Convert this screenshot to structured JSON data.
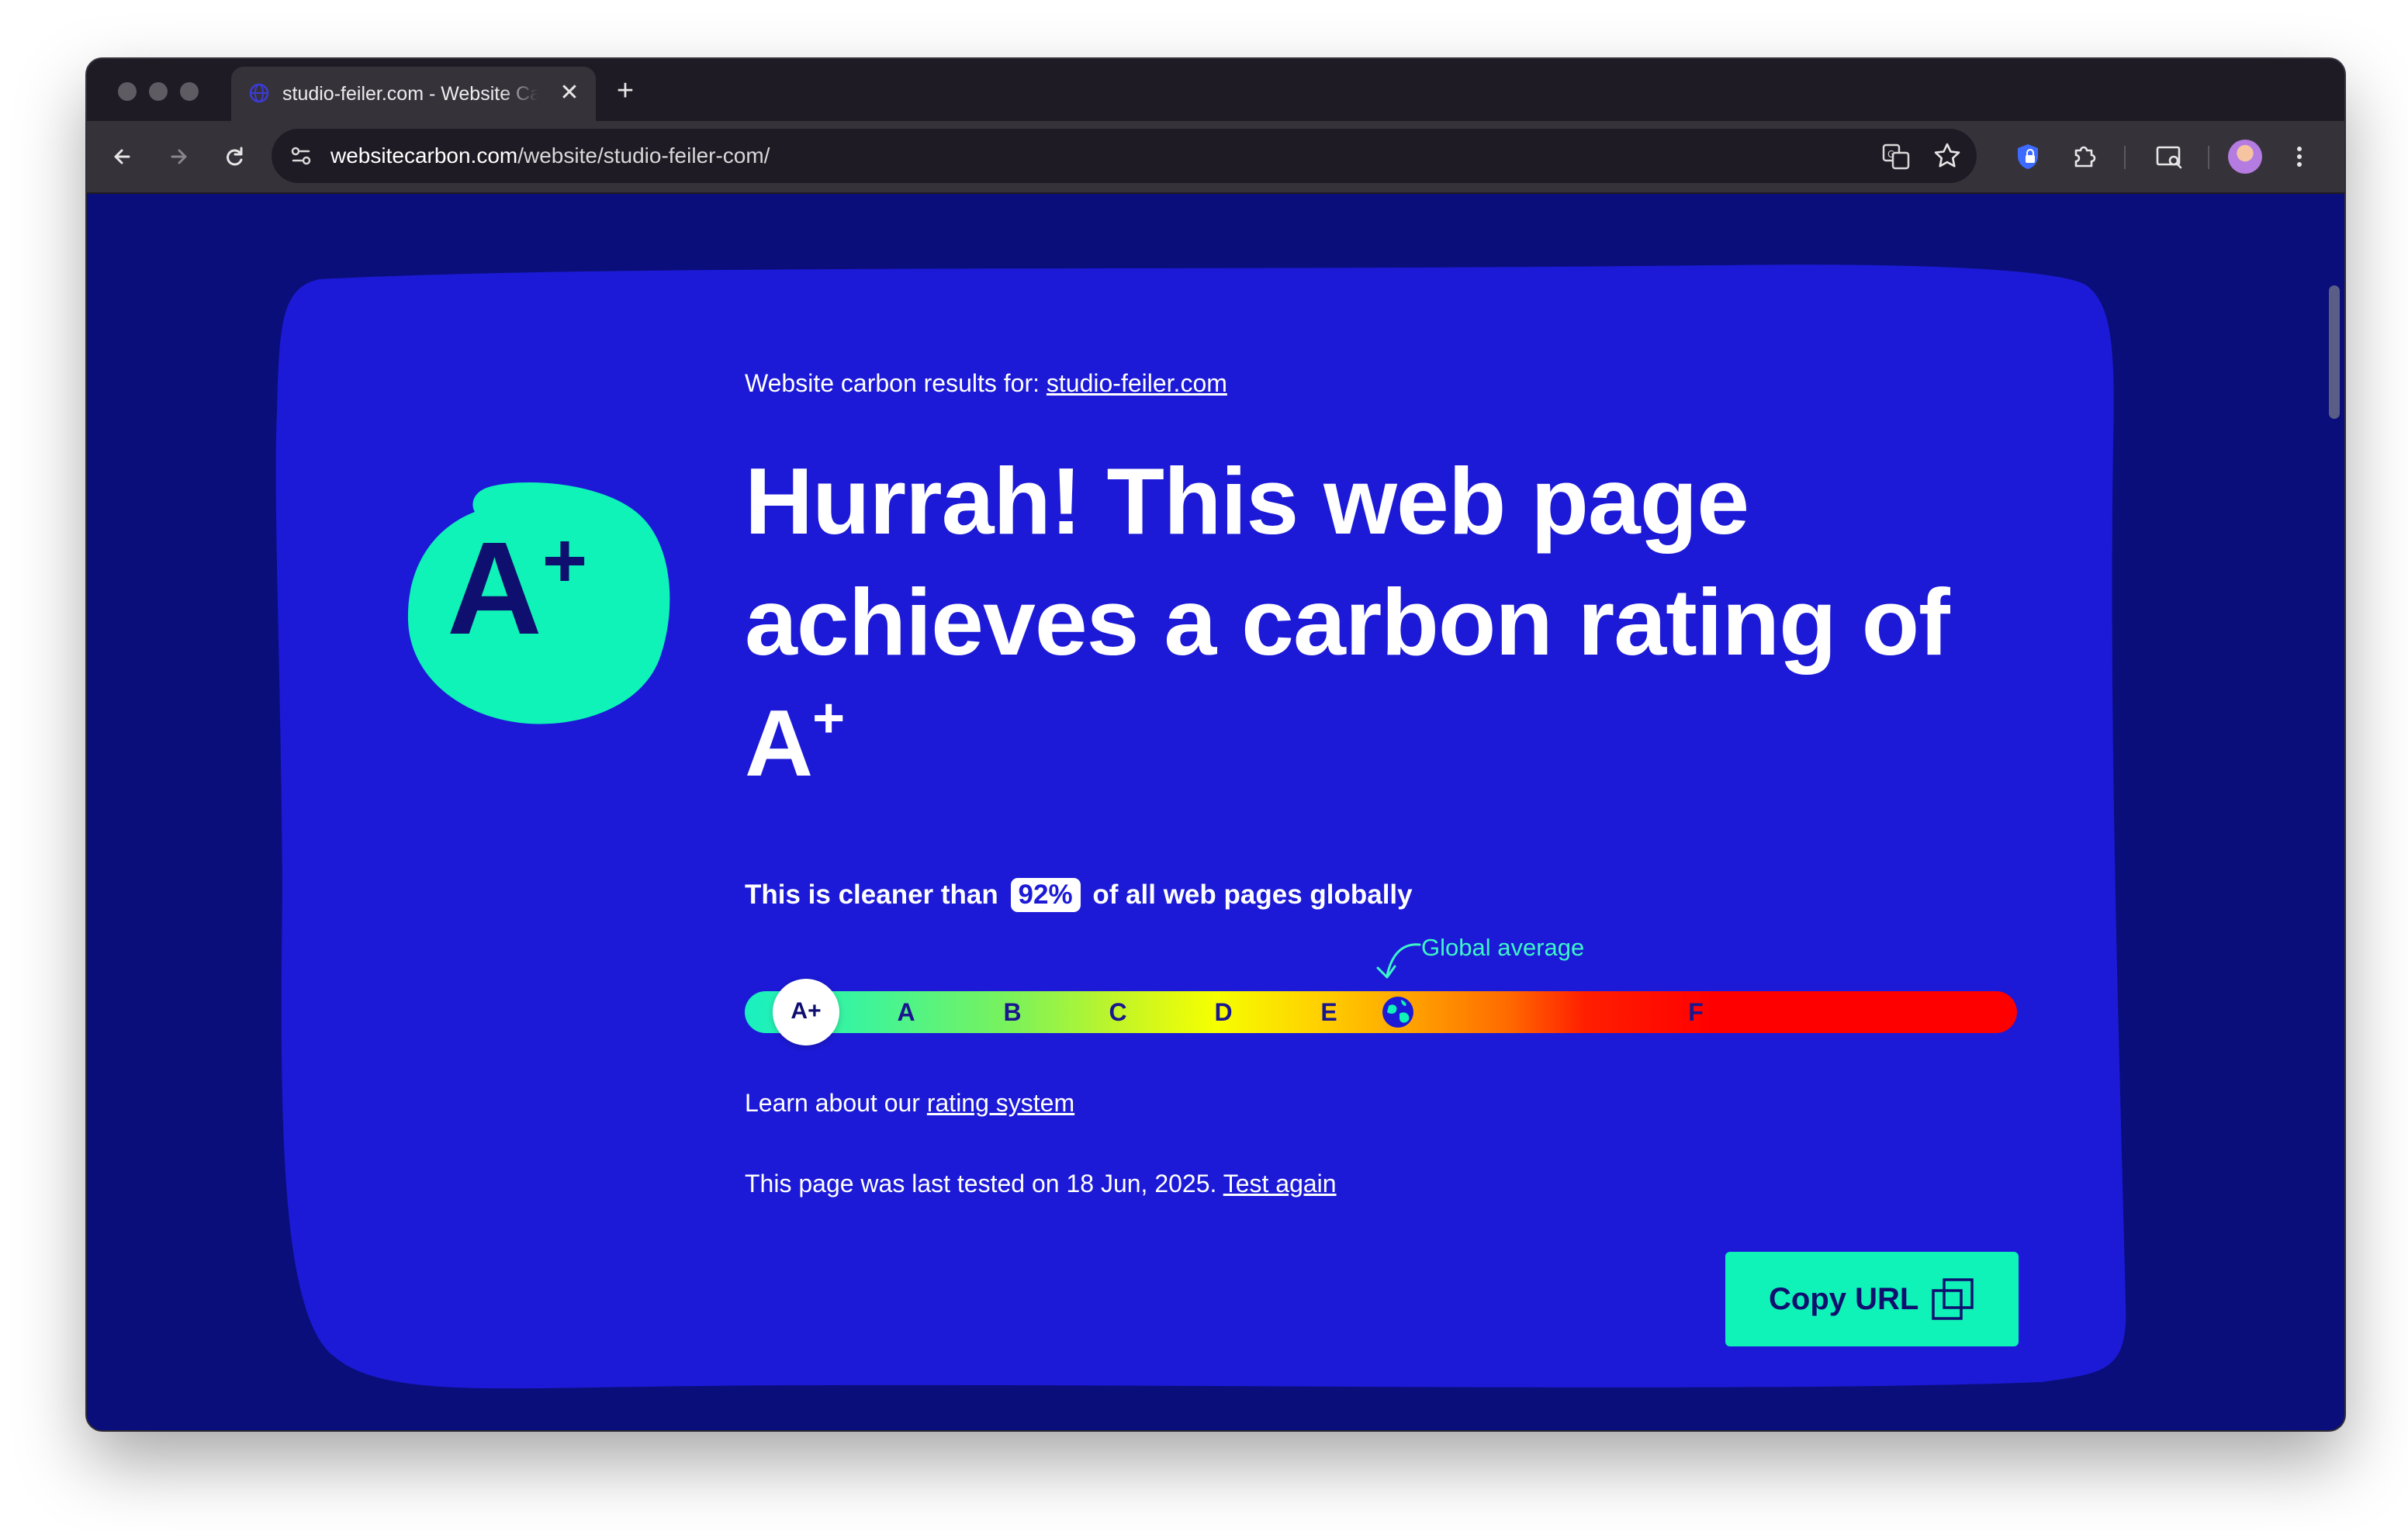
{
  "browser": {
    "tab_title": "studio-feiler.com - Website Carbon Calculator",
    "tab_close": "✕",
    "new_tab": "+",
    "url_host": "websitecarbon.com",
    "url_path": "/website/studio-feiler-com/",
    "icons": {
      "back": "back-arrow-icon",
      "forward": "forward-arrow-icon",
      "reload": "reload-icon",
      "site_info": "site-info-icon",
      "translate": "translate-icon",
      "bookmark": "star-icon",
      "extension_shield": "shield-extension-icon",
      "extensions": "puzzle-icon",
      "reading_mode": "reading-mode-icon",
      "profile": "avatar",
      "menu": "kebab-menu-icon"
    }
  },
  "page": {
    "results_for_label": "Website carbon results for:",
    "results_for_link": "studio-feiler.com",
    "badge_letter": "A",
    "badge_plus": "+",
    "headline": "Hurrah! This web page achieves a carbon rating of",
    "headline_grade": "A",
    "headline_grade_plus": "+",
    "cleaner_prefix": "This is cleaner than",
    "cleaner_percent": "92%",
    "cleaner_suffix": "of all web pages globally",
    "cleaner_percent_value": 92,
    "global_average_label": "Global average",
    "scale": {
      "current": "A+",
      "letters": [
        "A",
        "B",
        "C",
        "D",
        "E",
        "F"
      ]
    },
    "learn_prefix": "Learn about our",
    "learn_link": "rating system",
    "tested_prefix": "This page was last tested on 18 Jun, 2025.",
    "tested_link": "Test again",
    "copy_button": "Copy URL"
  },
  "colors": {
    "page_bg": "#0a0e7a",
    "card_bg": "#1c1ad6",
    "accent_green": "#0ff2b8",
    "text_dark": "#0e0f6e"
  }
}
